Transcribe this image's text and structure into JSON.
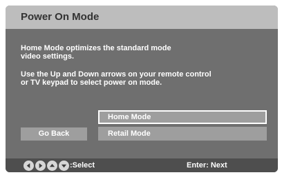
{
  "header": {
    "title": "Power On Mode"
  },
  "content": {
    "description_line1": "Home Mode optimizes the standard mode",
    "description_line2": "video settings.",
    "instruction_line1": "Use the Up and Down arrows on your remote control",
    "instruction_line2": "or TV keypad to select power on mode."
  },
  "options": {
    "home_mode": "Home Mode",
    "retail_mode": "Retail Mode",
    "selected": "Home Mode"
  },
  "buttons": {
    "go_back": "Go Back"
  },
  "footer": {
    "nav_icons": [
      "left-arrow-icon",
      "right-arrow-icon",
      "up-arrow-icon",
      "down-arrow-icon"
    ],
    "select_label": ":Select",
    "enter_label": "Enter: Next"
  },
  "colors": {
    "screen_background": "#6f6f6f",
    "title_bar": "#bdbdbd",
    "option_background": "#9e9e9e",
    "footer_background": "#4e4e4e",
    "text": "#ffffff"
  }
}
